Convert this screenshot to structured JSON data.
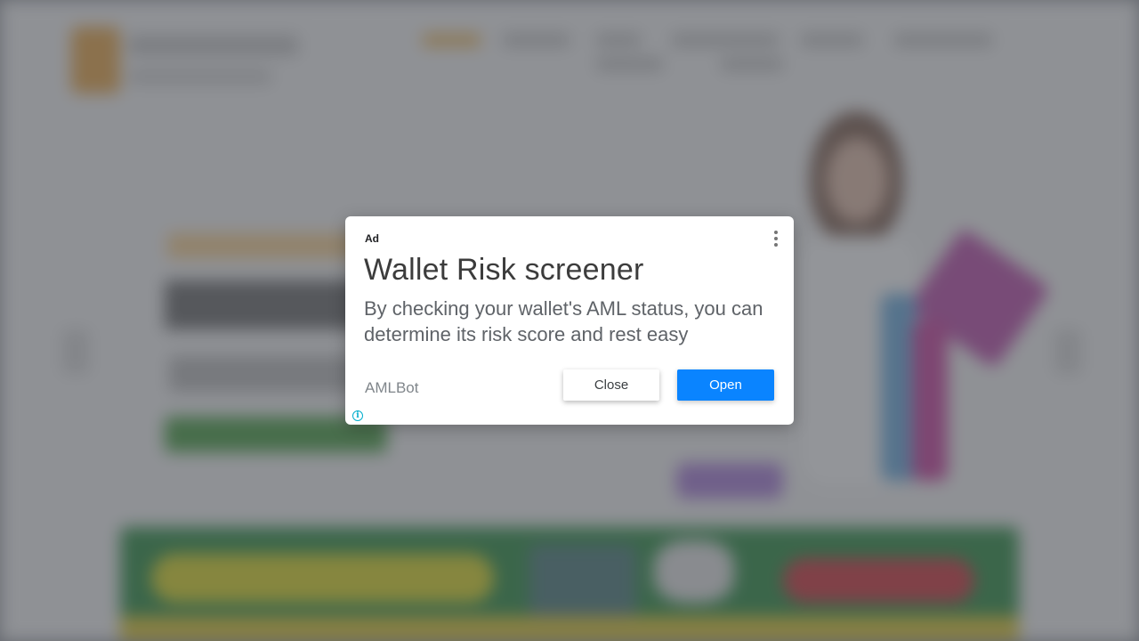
{
  "ad": {
    "badge": "Ad",
    "title": "Wallet Risk screener",
    "body": "By checking your wallet's AML status, you can determine its risk score and rest easy",
    "advertiser": "AMLBot",
    "close_label": "Close",
    "open_label": "Open",
    "info_glyph": "i",
    "menu_icon": "more-vertical-icon",
    "info_icon": "adchoices-info-icon"
  },
  "colors": {
    "open_button": "#0a84ff",
    "info_icon": "#00aecd",
    "overlay": "rgba(70,73,80,0.55)"
  }
}
